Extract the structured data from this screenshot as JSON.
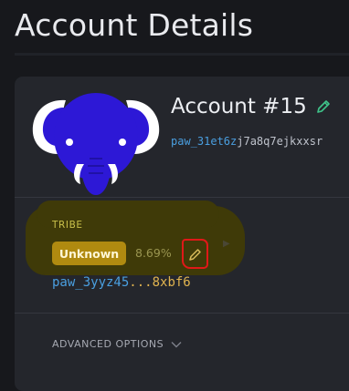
{
  "page": {
    "title": "Account Details"
  },
  "account": {
    "name": "Account #15",
    "address_highlight": "paw_31et6z",
    "address_rest": "j7a8q7ejkxxsr"
  },
  "tribe": {
    "label": "TRIBE",
    "status": "Unknown",
    "percent": "8.69%",
    "address_start": "paw_3yyz45",
    "address_ellipsis": "...",
    "address_end": "8xbf6"
  },
  "advanced": {
    "label": "ADVANCED OPTIONS"
  },
  "icons": {
    "avatar": "elephant-avatar",
    "edit": "pencil-icon",
    "expand": "chevron-down-icon"
  },
  "colors": {
    "accent_green": "#3fc48a",
    "accent_blue": "#4a9fe0",
    "badge_gold": "#b08a10",
    "annotation_red": "#e01818",
    "avatar_blue": "#2d18d6"
  }
}
